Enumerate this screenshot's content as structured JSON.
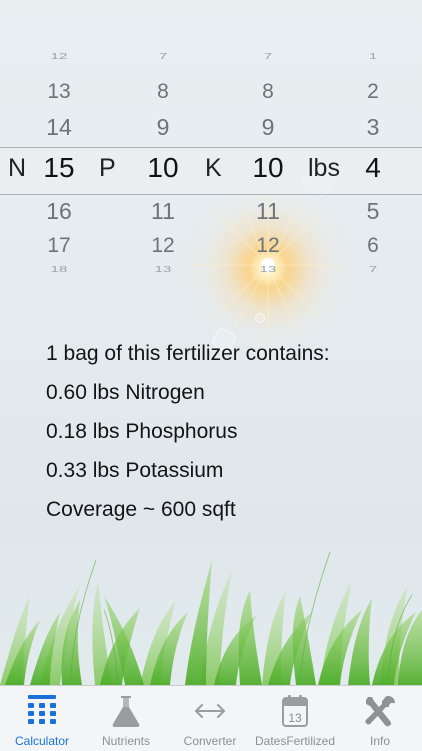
{
  "picker": {
    "nitrogen": {
      "label": "N",
      "values": [
        "12",
        "13",
        "14",
        "15",
        "16",
        "17",
        "18"
      ]
    },
    "phosphorus": {
      "label": "P",
      "values": [
        "7",
        "8",
        "9",
        "10",
        "11",
        "12",
        "13"
      ]
    },
    "potassium": {
      "label": "K",
      "values": [
        "7",
        "8",
        "9",
        "10",
        "11",
        "12",
        "13"
      ]
    },
    "weight": {
      "label": "lbs",
      "values": [
        "1",
        "2",
        "3",
        "4",
        "5",
        "6",
        "7"
      ]
    }
  },
  "results": {
    "line1": "1 bag of this fertilizer contains:",
    "line2": "0.60 lbs Nitrogen",
    "line3": "0.18 lbs Phosphorus",
    "line4": "0.33 lbs Potassium",
    "line5": "Coverage ~ 600 sqft"
  },
  "tabs": [
    {
      "label": "Calculator",
      "icon": "calculator-grid-icon",
      "active": true
    },
    {
      "label": "Nutrients",
      "icon": "flask-icon",
      "active": false
    },
    {
      "label": "Converter",
      "icon": "double-arrow-icon",
      "active": false
    },
    {
      "label": "DatesFertilized",
      "icon": "calendar-icon",
      "active": false
    },
    {
      "label": "Info",
      "icon": "tools-icon",
      "active": false
    }
  ],
  "calendar_icon_day": "13",
  "colors": {
    "active_tab": "#1a72d8",
    "inactive_tab": "#8e8e93",
    "grass": "#6cbf3c"
  }
}
